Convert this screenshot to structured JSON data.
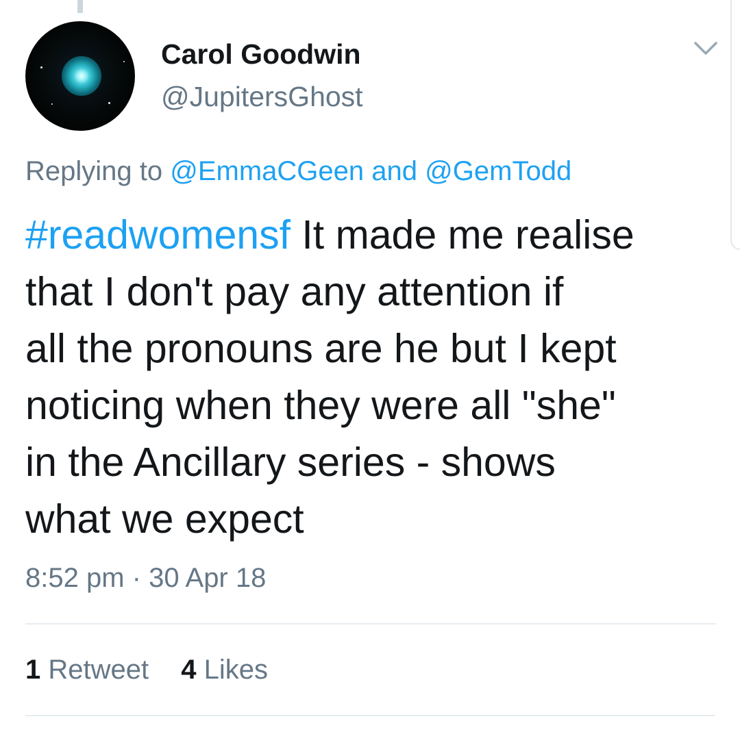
{
  "author": {
    "name": "Carol Goodwin",
    "handle": "@JupitersGhost"
  },
  "reply": {
    "prefix": "Replying to",
    "mention_1": "@EmmaCGeen",
    "conjunction": "and",
    "mention_2": "@GemTodd"
  },
  "tweet": {
    "hashtag": "#readwomensf",
    "lines": [
      " It made me realise",
      "that I don't pay any attention if",
      "all the pronouns are he but I kept",
      "noticing when they were all \"she\"",
      "in the Ancillary series - shows",
      "what we expect"
    ]
  },
  "meta": {
    "time": "8:52 pm",
    "separator": "·",
    "date": "30 Apr 18"
  },
  "stats": {
    "retweets_count": "1",
    "retweets_label": "Retweet",
    "likes_count": "4",
    "likes_label": "Likes"
  },
  "colors": {
    "link": "#1da1f2",
    "secondary_text": "#657786",
    "primary_text": "#14171a"
  },
  "icons": {
    "menu": "chevron-down-icon"
  }
}
